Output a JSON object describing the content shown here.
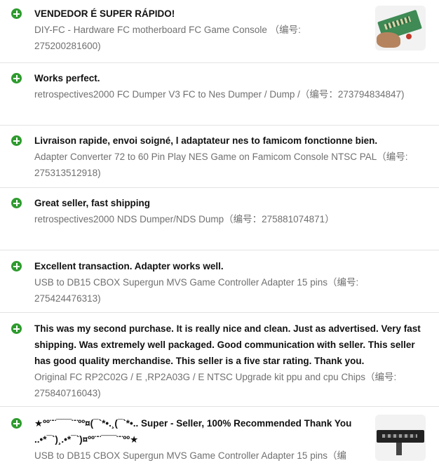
{
  "feedback": [
    {
      "comment": [
        "VENDEDOR É SUPER RÁPIDO!"
      ],
      "item": [
        "DIY-FC - Hardware FC motherboard FC Game Console （编号:",
        "275200281600)"
      ]
    },
    {
      "comment": [
        "Works perfect."
      ],
      "item": [
        "retrospectives2000 FC Dumper V3 FC to Nes Dumper / Dump /（编号：273794834847)"
      ]
    },
    {
      "comment": [
        "Livraison rapide, envoi soigné, l adaptateur nes to famicom fonctionne bien."
      ],
      "item": [
        "Adapter Converter 72 to 60 Pin Play NES Game on Famicom Console NTSC PAL（编号:",
        "275313512918)"
      ]
    },
    {
      "comment": [
        "Great seller, fast shipping"
      ],
      "item": [
        "retrospectives2000 NDS Dumper/NDS Dump（编号：275881074871）"
      ]
    },
    {
      "comment": [
        "Excellent transaction. Adapter works well."
      ],
      "item": [
        "USB to DB15 CBOX Supergun MVS Game Controller Adapter 15 pins（编号:",
        "275424476313)"
      ]
    },
    {
      "comment": [
        "This was my second purchase. It is really nice and clean. Just as advertised. Very fast",
        "shipping. Was extremely well packaged. Good communication with seller. This seller",
        "has good quality merchandise. This seller is a five star rating. Thank you."
      ],
      "item": [
        "Original FC RP2C02G / E ,RP2A03G / E NTSC Upgrade kit ppu and cpu Chips（编号:",
        "275840716043)"
      ]
    },
    {
      "comment": [
        "★ºº¨¨¯¯¯¨¨ºº¤(¯`*•.¸(¯`*•.. Super - Seller, 100% Recommended Thank You",
        "..•*¯`)¸.•*¯`)¤ºº¨¨¯¯¯¨¨ºº★"
      ],
      "item": [
        "USB to DB15 CBOX Supergun MVS Game Controller Adapter 15 pins（编"
      ]
    }
  ],
  "colors": {
    "plus_icon": "#2e9b2e",
    "comment_text": "#111111",
    "item_text": "#707070",
    "divider": "#e3e3e3"
  },
  "icons": {
    "row_icon": "plus-circle-icon"
  }
}
